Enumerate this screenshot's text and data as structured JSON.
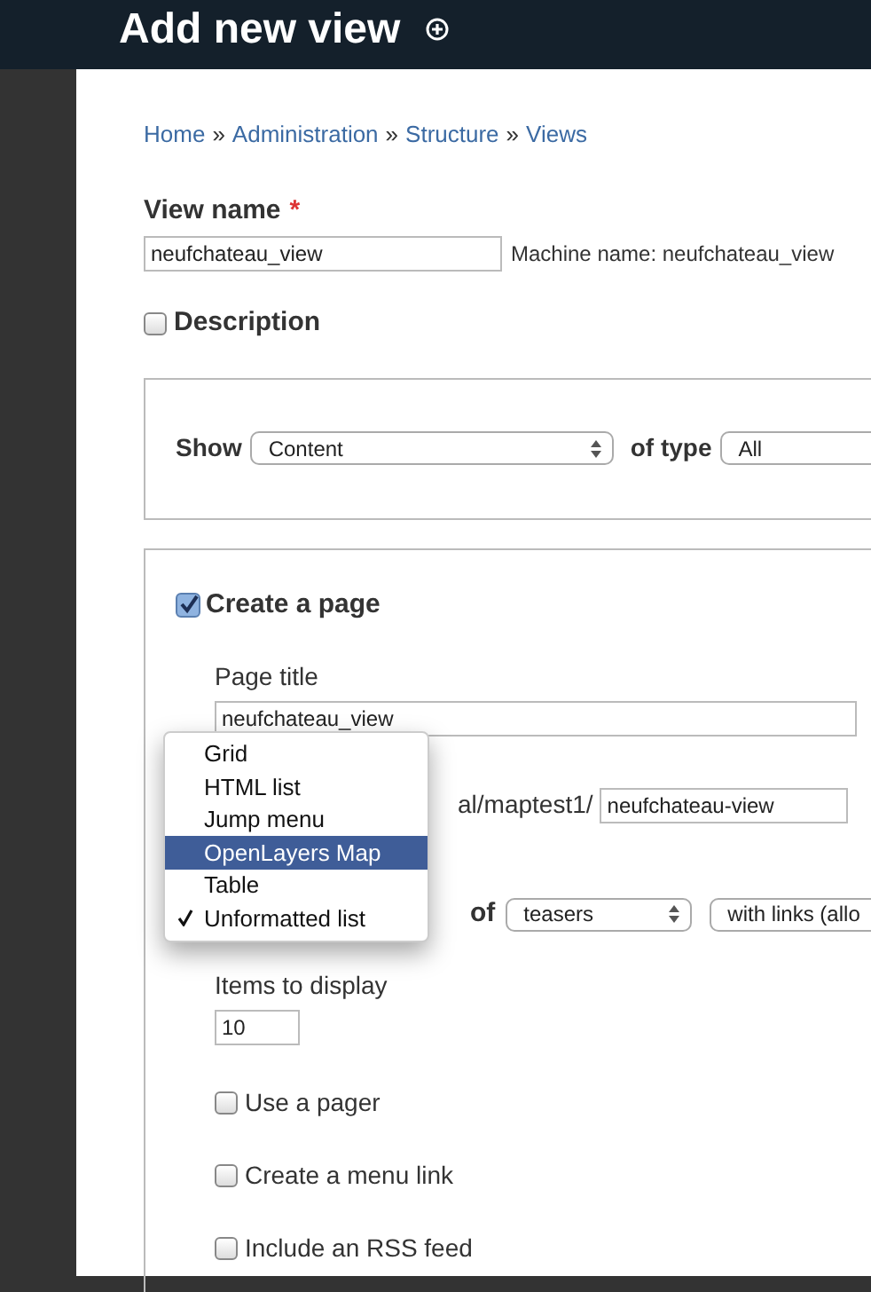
{
  "header": {
    "title": "Add new view"
  },
  "breadcrumb": {
    "separator": "»",
    "items": [
      "Home",
      "Administration",
      "Structure",
      "Views"
    ]
  },
  "view_name": {
    "label": "View name",
    "required_mark": "*",
    "value": "neufchateau_view",
    "machine_name": "Machine name: neufchateau_view"
  },
  "description": {
    "label": "Description",
    "checked": false
  },
  "show": {
    "label": "Show",
    "value": "Content",
    "of_type_label": "of type",
    "of_type_value": "All"
  },
  "page": {
    "label": "Create a page",
    "checked": true,
    "title_label": "Page title",
    "title_value": "neufchateau_view",
    "path_prefix": "al/maptest1/",
    "path_value": "neufchateau-view",
    "of_label": "of",
    "of_value": "teasers",
    "links_value": "with links (allo",
    "items_label": "Items to display",
    "items_value": "10",
    "options": [
      {
        "label": "Use a pager",
        "checked": false
      },
      {
        "label": "Create a menu link",
        "checked": false
      },
      {
        "label": "Include an RSS feed",
        "checked": false
      }
    ]
  },
  "format_menu": {
    "items": [
      {
        "label": "Grid",
        "selected": false,
        "checked": false
      },
      {
        "label": "HTML list",
        "selected": false,
        "checked": false
      },
      {
        "label": "Jump menu",
        "selected": false,
        "checked": false
      },
      {
        "label": "OpenLayers Map",
        "selected": true,
        "checked": false
      },
      {
        "label": "Table",
        "selected": false,
        "checked": false
      },
      {
        "label": "Unformatted list",
        "selected": false,
        "checked": true
      }
    ]
  }
}
